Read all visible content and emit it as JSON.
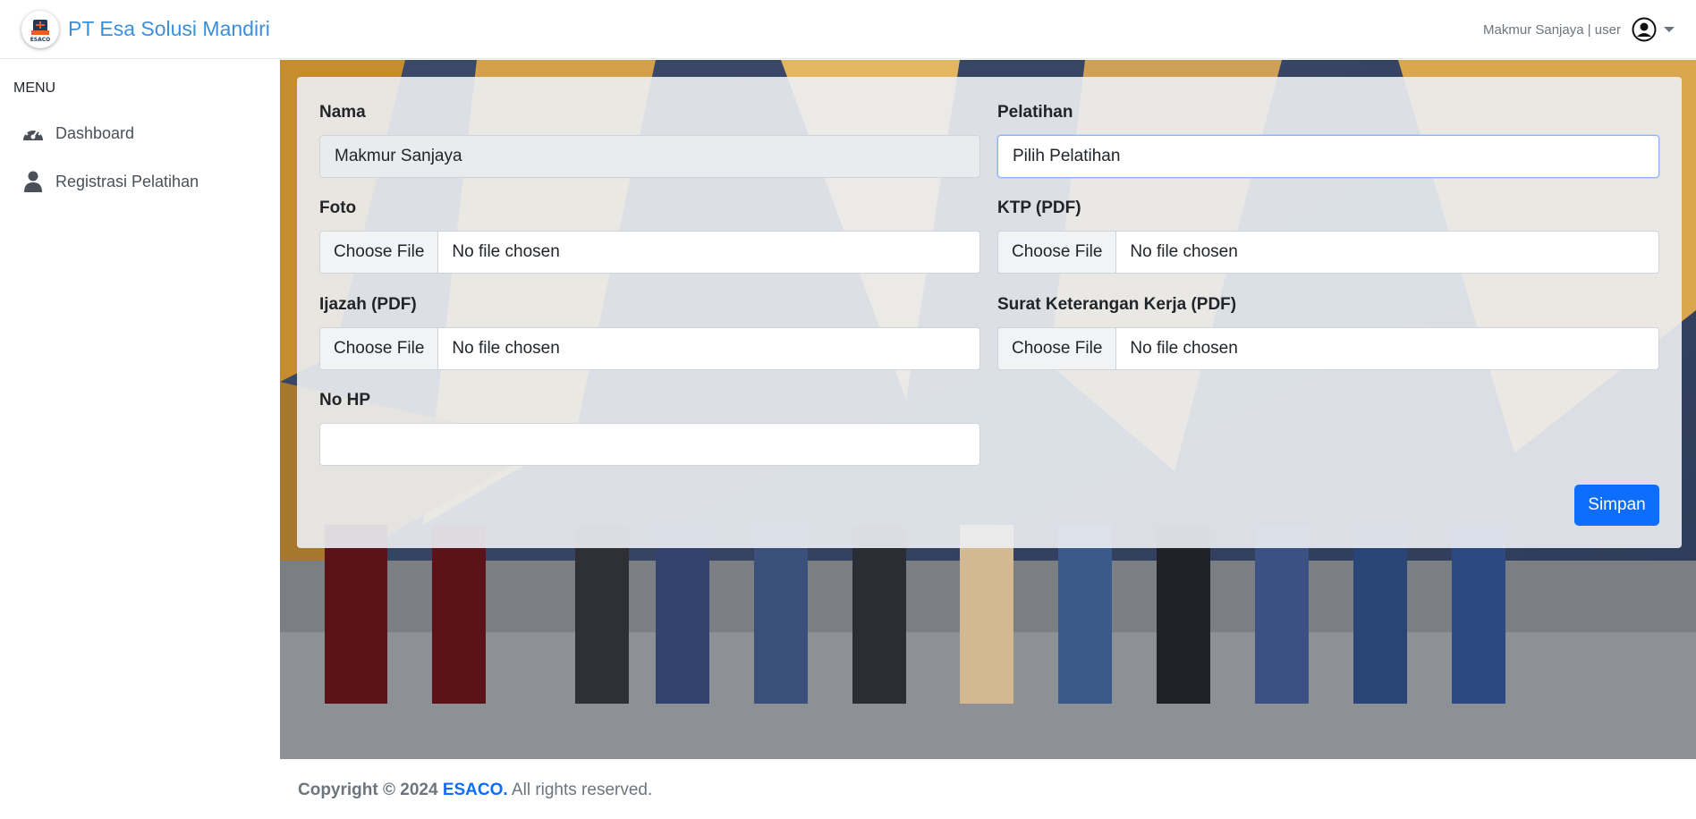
{
  "navbar": {
    "brand_text": "PT Esa Solusi Mandiri",
    "logo_text": "ESACO",
    "user_text": "Makmur Sanjaya | user"
  },
  "sidebar": {
    "heading": "MENU",
    "items": [
      {
        "label": "Dashboard",
        "icon": "tachometer-icon"
      },
      {
        "label": "Registrasi Pelatihan",
        "icon": "user-icon"
      }
    ]
  },
  "form": {
    "nama": {
      "label": "Nama",
      "value": "Makmur Sanjaya"
    },
    "pelatihan": {
      "label": "Pelatihan",
      "value": "Pilih Pelatihan"
    },
    "foto": {
      "label": "Foto",
      "button": "Choose File",
      "status": "No file chosen"
    },
    "ktp": {
      "label": "KTP (PDF)",
      "button": "Choose File",
      "status": "No file chosen"
    },
    "ijazah": {
      "label": "Ijazah (PDF)",
      "button": "Choose File",
      "status": "No file chosen"
    },
    "surat": {
      "label": "Surat Keterangan Kerja (PDF)",
      "button": "Choose File",
      "status": "No file chosen"
    },
    "nohp": {
      "label": "No HP",
      "value": ""
    },
    "submit_label": "Simpan"
  },
  "footer": {
    "prefix": "Copyright © 2024",
    "brand": "ESACO.",
    "suffix": "All rights reserved."
  },
  "colors": {
    "brand": "#3b8fd9",
    "primary": "#0d6efd",
    "muted": "#6c757d"
  }
}
